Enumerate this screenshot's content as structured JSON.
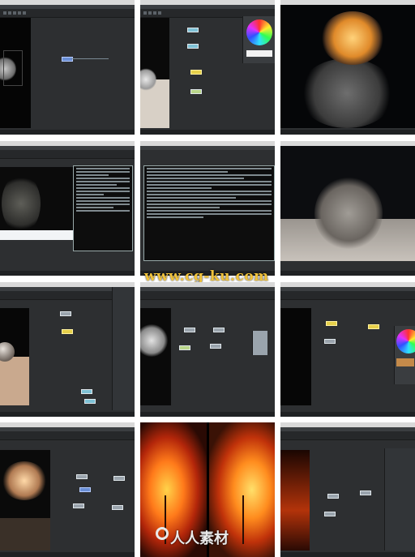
{
  "page": {
    "background": "#ffffff"
  },
  "tiles": [
    {
      "id": 1,
      "desc": "node-editor-with-smoke-viewport"
    },
    {
      "id": 2,
      "desc": "node-editor-with-color-wheel"
    },
    {
      "id": 3,
      "desc": "explosion-render"
    },
    {
      "id": 4,
      "desc": "smoke-render-with-terminal-log"
    },
    {
      "id": 5,
      "desc": "terminal-statistics"
    },
    {
      "id": 6,
      "desc": "smoke-on-ground-render"
    },
    {
      "id": 7,
      "desc": "sphere-scene-node-graph"
    },
    {
      "id": 8,
      "desc": "smoke-closeup-node-graph"
    },
    {
      "id": 9,
      "desc": "node-graph-with-color-wheel"
    },
    {
      "id": 10,
      "desc": "explosion-node-graph"
    },
    {
      "id": 11,
      "desc": "fire-tree-comparison"
    },
    {
      "id": 12,
      "desc": "fire-node-graph"
    }
  ],
  "watermark": {
    "text": "www.cg-ku.com",
    "color": "#f0c23a"
  },
  "watermark_bottom": {
    "text": "人人素材"
  },
  "colors": {
    "ui_dark": "#2d2f31",
    "node_yellow": "#e6d04a",
    "node_grey": "#9aa4ad",
    "fire": "#ff7a1a"
  }
}
